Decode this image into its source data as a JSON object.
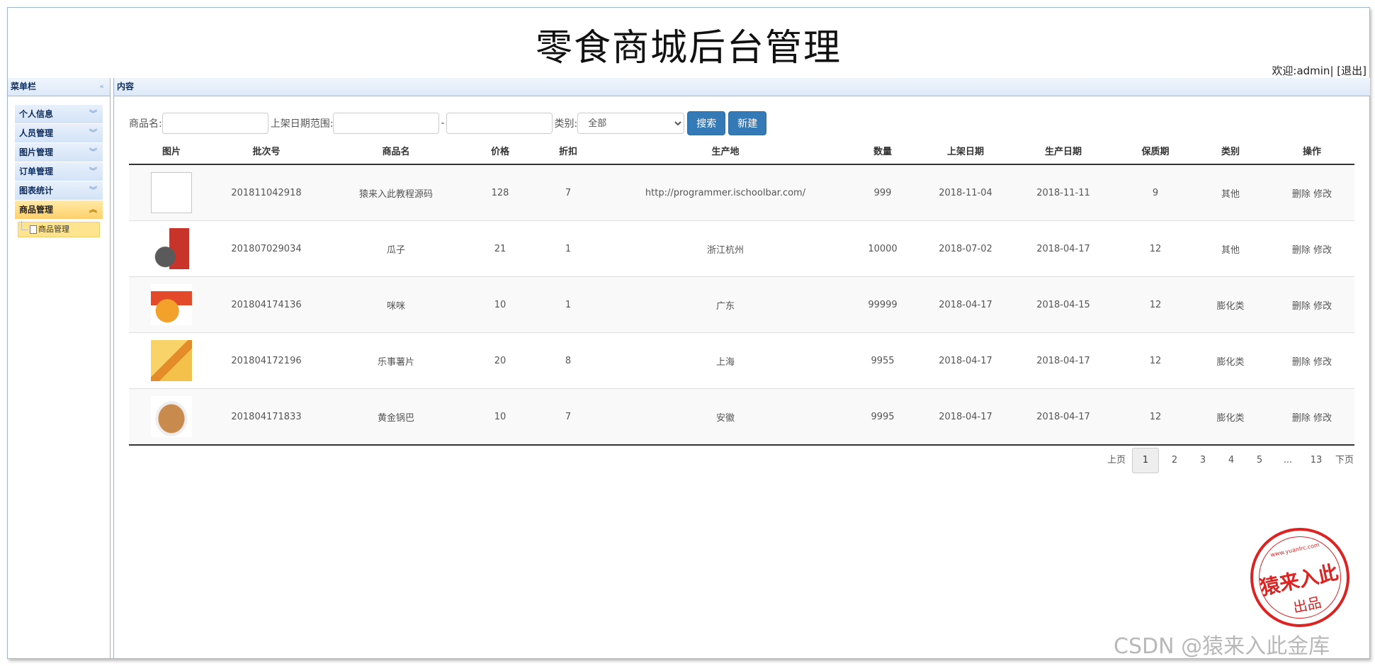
{
  "header": {
    "title": "零食商城后台管理",
    "welcome_text": "欢迎:admin| ",
    "logout_label": "[退出]"
  },
  "sidebar": {
    "title": "菜单栏",
    "items": [
      {
        "label": "个人信息"
      },
      {
        "label": "人员管理"
      },
      {
        "label": "图片管理"
      },
      {
        "label": "订单管理"
      },
      {
        "label": "图表统计"
      },
      {
        "label": "商品管理"
      }
    ],
    "active_sub_item": "商品管理"
  },
  "content": {
    "title": "内容"
  },
  "search": {
    "name_label": "商品名:",
    "date_label": "上架日期范围:",
    "date_separator": "-",
    "category_label": "类别:",
    "category_selected": "全部",
    "search_button": "搜索",
    "new_button": "新建"
  },
  "table": {
    "headers": [
      "图片",
      "批次号",
      "商品名",
      "价格",
      "折扣",
      "生产地",
      "数量",
      "上架日期",
      "生产日期",
      "保质期",
      "类别",
      "操作"
    ],
    "delete_label": "删除",
    "edit_label": "修改",
    "rows": [
      {
        "image": "broken-image",
        "batch": "201811042918",
        "name": "猿来入此教程源码",
        "price": "128",
        "discount": "7",
        "origin": "http://programmer.ischoolbar.com/",
        "quantity": "999",
        "list_date": "2018-11-04",
        "produce_date": "2018-11-11",
        "shelf_life": "9",
        "category": "其他"
      },
      {
        "image": "sunflower-seeds-image",
        "batch": "201807029034",
        "name": "瓜子",
        "price": "21",
        "discount": "1",
        "origin": "浙江杭州",
        "quantity": "10000",
        "list_date": "2018-07-02",
        "produce_date": "2018-04-17",
        "shelf_life": "12",
        "category": "其他"
      },
      {
        "image": "snack-sticks-image",
        "batch": "201804174136",
        "name": "咪咪",
        "price": "10",
        "discount": "1",
        "origin": "广东",
        "quantity": "99999",
        "list_date": "2018-04-17",
        "produce_date": "2018-04-15",
        "shelf_life": "12",
        "category": "膨化类"
      },
      {
        "image": "potato-chips-image",
        "batch": "201804172196",
        "name": "乐事薯片",
        "price": "20",
        "discount": "8",
        "origin": "上海",
        "quantity": "9955",
        "list_date": "2018-04-17",
        "produce_date": "2018-04-17",
        "shelf_life": "12",
        "category": "膨化类"
      },
      {
        "image": "rice-crust-image",
        "batch": "201804171833",
        "name": "黄金锅巴",
        "price": "10",
        "discount": "7",
        "origin": "安徽",
        "quantity": "9995",
        "list_date": "2018-04-17",
        "produce_date": "2018-04-17",
        "shelf_life": "12",
        "category": "膨化类"
      }
    ]
  },
  "pagination": {
    "prev": "上页",
    "pages": [
      "1",
      "2",
      "3",
      "4",
      "5"
    ],
    "ellipsis": "...",
    "last": "13",
    "next": "下页",
    "current": "1"
  },
  "stamp": {
    "url": "www.yuanlrc.com",
    "main": "猿来入此",
    "sub": "出品"
  },
  "watermark": "CSDN @猿来入此金库"
}
